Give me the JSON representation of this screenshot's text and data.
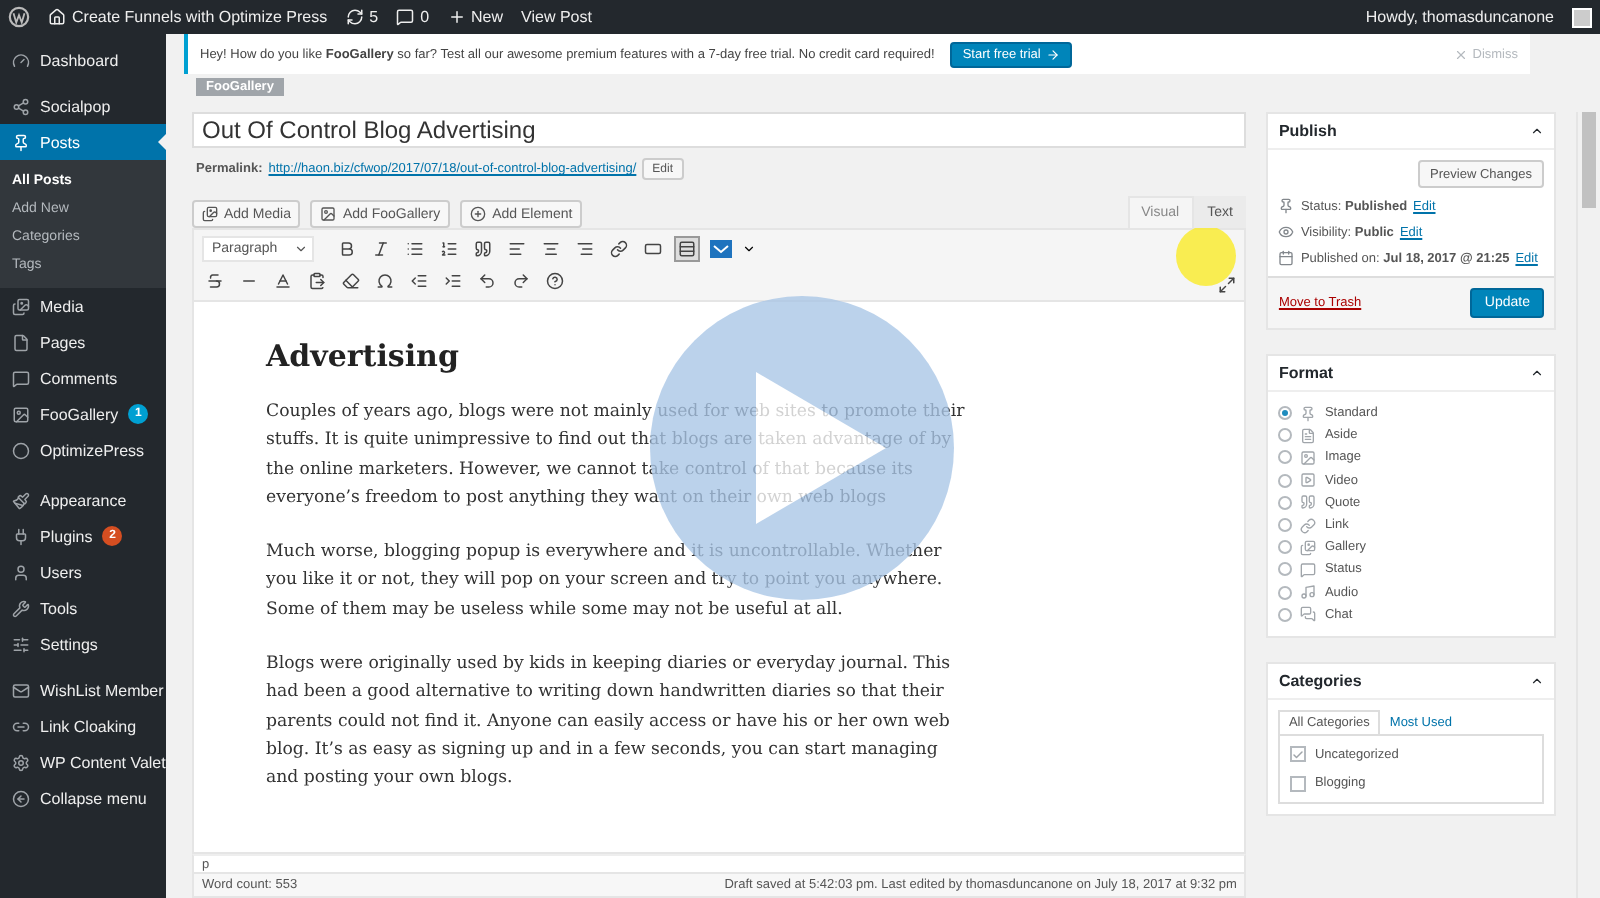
{
  "admin_bar": {
    "site": "Create Funnels with Optimize Press",
    "updates": "5",
    "comments": "0",
    "new": "New",
    "view": "View Post",
    "howdy": "Howdy, thomasduncanone"
  },
  "sidebar": {
    "groups": [
      [
        {
          "label": "Dashboard",
          "selected": false
        }
      ],
      [
        {
          "label": "Socialpop",
          "selected": false
        },
        {
          "label": "Posts",
          "selected": true,
          "children": [
            {
              "label": "All Posts",
              "selected": true
            },
            {
              "label": "Add New",
              "selected": false
            },
            {
              "label": "Categories",
              "selected": false
            },
            {
              "label": "Tags",
              "selected": false
            }
          ]
        },
        {
          "label": "Media",
          "selected": false
        },
        {
          "label": "Pages",
          "selected": false
        },
        {
          "label": "Comments",
          "selected": false
        },
        {
          "label": "FooGallery",
          "selected": false,
          "badge": {
            "text": "1",
            "color": "#00a0d2"
          }
        },
        {
          "label": "OptimizePress",
          "selected": false
        }
      ],
      [
        {
          "label": "Appearance",
          "selected": false
        },
        {
          "label": "Plugins",
          "selected": false,
          "badge": {
            "text": "2",
            "color": "#d54e21"
          }
        },
        {
          "label": "Users",
          "selected": false
        },
        {
          "label": "Tools",
          "selected": false
        },
        {
          "label": "Settings",
          "selected": false
        }
      ],
      [
        {
          "label": "WishList Member",
          "selected": false
        },
        {
          "label": "Link Cloaking",
          "selected": false
        },
        {
          "label": "WP Content Valet",
          "selected": false
        },
        {
          "label": "Collapse menu",
          "selected": false
        }
      ]
    ]
  },
  "notice": {
    "text": "Hey! How do you like **FooGallery** so far? Test all our awesome premium features with a 7-day free trial. No credit card required!",
    "button": "Start free trial",
    "dismiss": "Dismiss"
  },
  "tag": "FooGallery",
  "editor": {
    "title": "Out Of Control Blog Advertising",
    "permalink_label": "Permalink:",
    "permalink": "http://haon.biz/cfwop/2017/07/18/out-of-control-blog-advertising/",
    "permalink_edit": "Edit",
    "media_buttons": [
      "Add Media",
      "Add FooGallery",
      "Add Element"
    ],
    "tabs": [
      {
        "label": "Visual",
        "selected": true
      },
      {
        "label": "Text",
        "selected": false
      }
    ],
    "format_select": "Paragraph",
    "toolbar_toggle_on": true,
    "heading": "Advertising",
    "paragraphs": [
      "Couples of years ago, blogs were not mainly used for web sites to promote their stuffs. It is quite unimpressive to find out that blogs are taken advantage of by the online marketers. However, we cannot take control of that because its everyone’s freedom to post anything they want on their own web blogs",
      "Much worse, blogging popup is everywhere and it is uncontrollable. Whether you like it or not, they will pop on your screen and try to point you anywhere. Some of them may be useless while some may not be useful at all.",
      "Blogs were originally used by kids in keeping diaries or everyday journal. This had been a good alternative to writing down handwritten diaries so that their parents could not find it. Anyone can easily access or have his or her own web blog. It’s as easy as signing up and in a few seconds, you can start managing and posting your own blogs."
    ],
    "path": "p",
    "word_count": "Word count: 553",
    "status": "Draft saved at 5:42:03 pm. Last edited by thomasduncanone on July 18, 2017 at 9:32 pm"
  },
  "publish": {
    "title": "Publish",
    "preview": "Preview Changes",
    "rows": [
      {
        "text": "Status: **Published**",
        "edit": "Edit"
      },
      {
        "text": "Visibility: **Public**",
        "edit": "Edit"
      },
      {
        "text": "Published on: **Jul 18, 2017 @ 21:25**",
        "edit": "Edit"
      }
    ],
    "trash": "Move to Trash",
    "update": "Update"
  },
  "format": {
    "title": "Format",
    "options": [
      {
        "label": "Standard",
        "selected": true
      },
      {
        "label": "Aside",
        "selected": false
      },
      {
        "label": "Image",
        "selected": false
      },
      {
        "label": "Video",
        "selected": false
      },
      {
        "label": "Quote",
        "selected": false
      },
      {
        "label": "Link",
        "selected": false
      },
      {
        "label": "Gallery",
        "selected": false
      },
      {
        "label": "Status",
        "selected": false
      },
      {
        "label": "Audio",
        "selected": false
      },
      {
        "label": "Chat",
        "selected": false
      }
    ]
  },
  "categories": {
    "title": "Categories",
    "tabs": [
      {
        "label": "All Categories",
        "selected": true
      },
      {
        "label": "Most Used",
        "selected": false
      }
    ],
    "items": [
      {
        "label": "Uncategorized",
        "checked": true
      },
      {
        "label": "Blogging",
        "checked": false
      }
    ]
  }
}
